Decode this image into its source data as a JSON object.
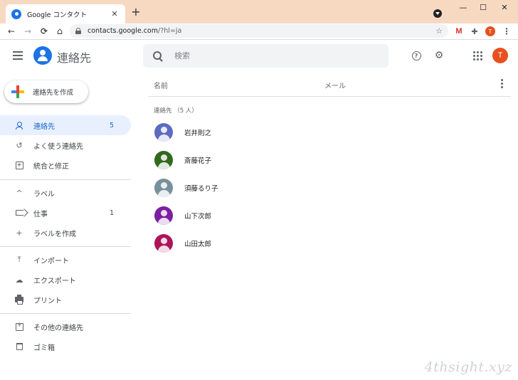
{
  "browser": {
    "tab_title": "Google コンタクト",
    "tab_close": "✕",
    "new_tab": "+",
    "url_host": "contacts.google.com",
    "url_path": "/?hl=ja",
    "win_minimize": "—",
    "win_maximize": "☐",
    "win_close": "✕",
    "back": "←",
    "forward": "→",
    "reload": "⟳",
    "home": "⌂",
    "star": "☆",
    "gmail": "M",
    "puzzle": "✚",
    "profile_initial": "T",
    "menu": "⋮"
  },
  "header": {
    "app_name": "連絡先",
    "search_placeholder": "検索",
    "help_glyph": "?",
    "settings_glyph": "⚙",
    "user_initial": "T"
  },
  "sidebar": {
    "create_label": "連絡先を作成",
    "items": [
      {
        "label": "連絡先",
        "count": "5",
        "icon": "person-icon"
      },
      {
        "label": "よく使う連絡先",
        "count": "",
        "icon": "history-icon",
        "glyph": "↺"
      },
      {
        "label": "統合と修正",
        "count": "",
        "icon": "merge-icon",
        "glyph": "+"
      }
    ],
    "labels_header": {
      "label": "ラベル",
      "glyph": "^"
    },
    "label_items": [
      {
        "label": "仕事",
        "count": "1",
        "icon": "label-icon"
      },
      {
        "label": "ラベルを作成",
        "count": "",
        "icon": "plus-icon",
        "glyph": "+"
      }
    ],
    "tools": [
      {
        "label": "インポート",
        "icon": "upload-icon",
        "glyph": "⤒"
      },
      {
        "label": "エクスポート",
        "icon": "cloud-download-icon",
        "glyph": "☁"
      },
      {
        "label": "プリント",
        "icon": "print-icon"
      }
    ],
    "bottom": [
      {
        "label": "その他の連絡先",
        "icon": "archive-icon"
      },
      {
        "label": "ゴミ箱",
        "icon": "trash-icon"
      }
    ]
  },
  "main": {
    "col_name": "名前",
    "col_email": "メール",
    "section_title": "連絡先 （5 人）",
    "contacts": [
      {
        "name": "岩井則之",
        "color": "#5c6bc0"
      },
      {
        "name": "斎藤花子",
        "color": "#33691e"
      },
      {
        "name": "須藤るり子",
        "color": "#78909c"
      },
      {
        "name": "山下次郎",
        "color": "#7b1fa2"
      },
      {
        "name": "山田太郎",
        "color": "#ad1457"
      }
    ]
  },
  "watermark": "4thsight.xyz",
  "colors": {
    "accent": "#1a73e8",
    "active_bg": "#e8f0fe",
    "avatar": "#e8501f",
    "titlebar": "#f7d9c2"
  }
}
